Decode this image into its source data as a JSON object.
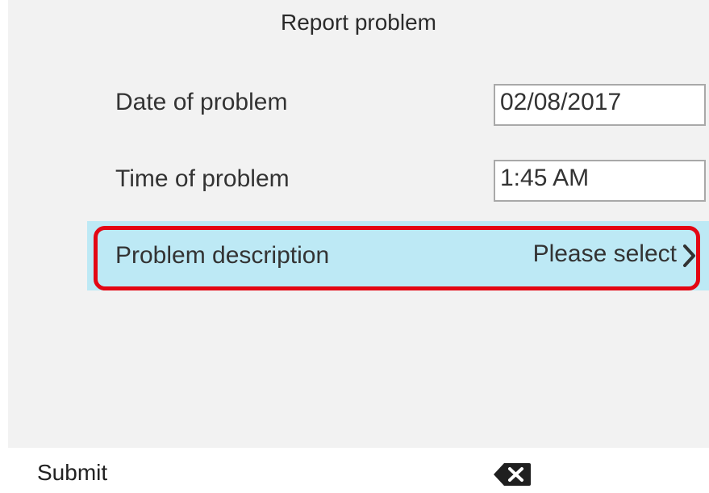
{
  "title": "Report problem",
  "date_row": {
    "label": "Date of problem",
    "value": "02/08/2017"
  },
  "time_row": {
    "label": "Time of problem",
    "value": "1:45 AM"
  },
  "description_row": {
    "label": "Problem description",
    "value": "Please select"
  },
  "softkeys": {
    "submit": "Submit",
    "backspace_icon": "backspace-icon"
  },
  "colors": {
    "selected_row": "#bde9f5",
    "highlight_border": "#e30613"
  }
}
